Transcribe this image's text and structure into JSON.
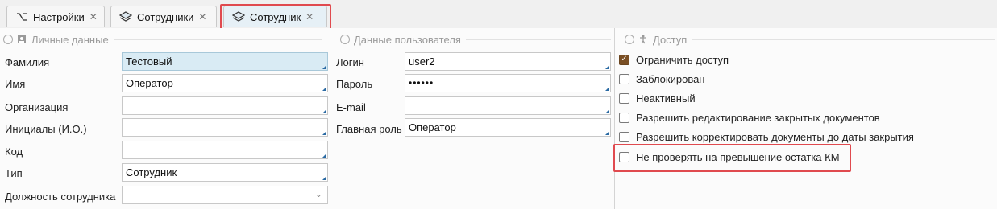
{
  "tabs": [
    {
      "label": "Настройки",
      "icon": "settings-icon",
      "close": "✕"
    },
    {
      "label": "Сотрудники",
      "icon": "layers-icon",
      "close": "✕"
    },
    {
      "label": "Сотрудник",
      "icon": "layers-icon",
      "close": "✕",
      "active": true
    }
  ],
  "personal": {
    "title": "Личные данные",
    "icon": "person-card-icon",
    "fields": [
      {
        "label": "Фамилия",
        "value": "Тестовый"
      },
      {
        "label": "Имя",
        "value": "Оператор"
      },
      {
        "label": "Организация",
        "value": ""
      },
      {
        "label": "Инициалы (И.О.)",
        "value": ""
      },
      {
        "label": "Код",
        "value": ""
      },
      {
        "label": "Тип",
        "value": "Сотрудник"
      },
      {
        "label": "Должность сотрудника",
        "value": ""
      }
    ]
  },
  "user": {
    "title": "Данные пользователя",
    "fields": [
      {
        "label": "Логин",
        "value": "user2"
      },
      {
        "label": "Пароль",
        "value": "••••••"
      },
      {
        "label": "E-mail",
        "value": ""
      },
      {
        "label": "Главная роль",
        "value": "Оператор"
      }
    ]
  },
  "access": {
    "title": "Доступ",
    "icon": "accessibility-icon",
    "options": [
      {
        "label": "Ограничить доступ",
        "checked": true
      },
      {
        "label": "Заблокирован",
        "checked": false
      },
      {
        "label": "Неактивный",
        "checked": false
      },
      {
        "label": "Разрешить редактирование закрытых документов",
        "checked": false
      },
      {
        "label": "Разрешить корректировать документы до даты закрытия",
        "checked": false
      },
      {
        "label": "Не проверять на превышение остатка КМ",
        "checked": false
      }
    ]
  },
  "colors": {
    "highlight": "#e04a4f",
    "checkbox_checked": "#7a4f24",
    "field_filled": "#d9ebf4"
  }
}
